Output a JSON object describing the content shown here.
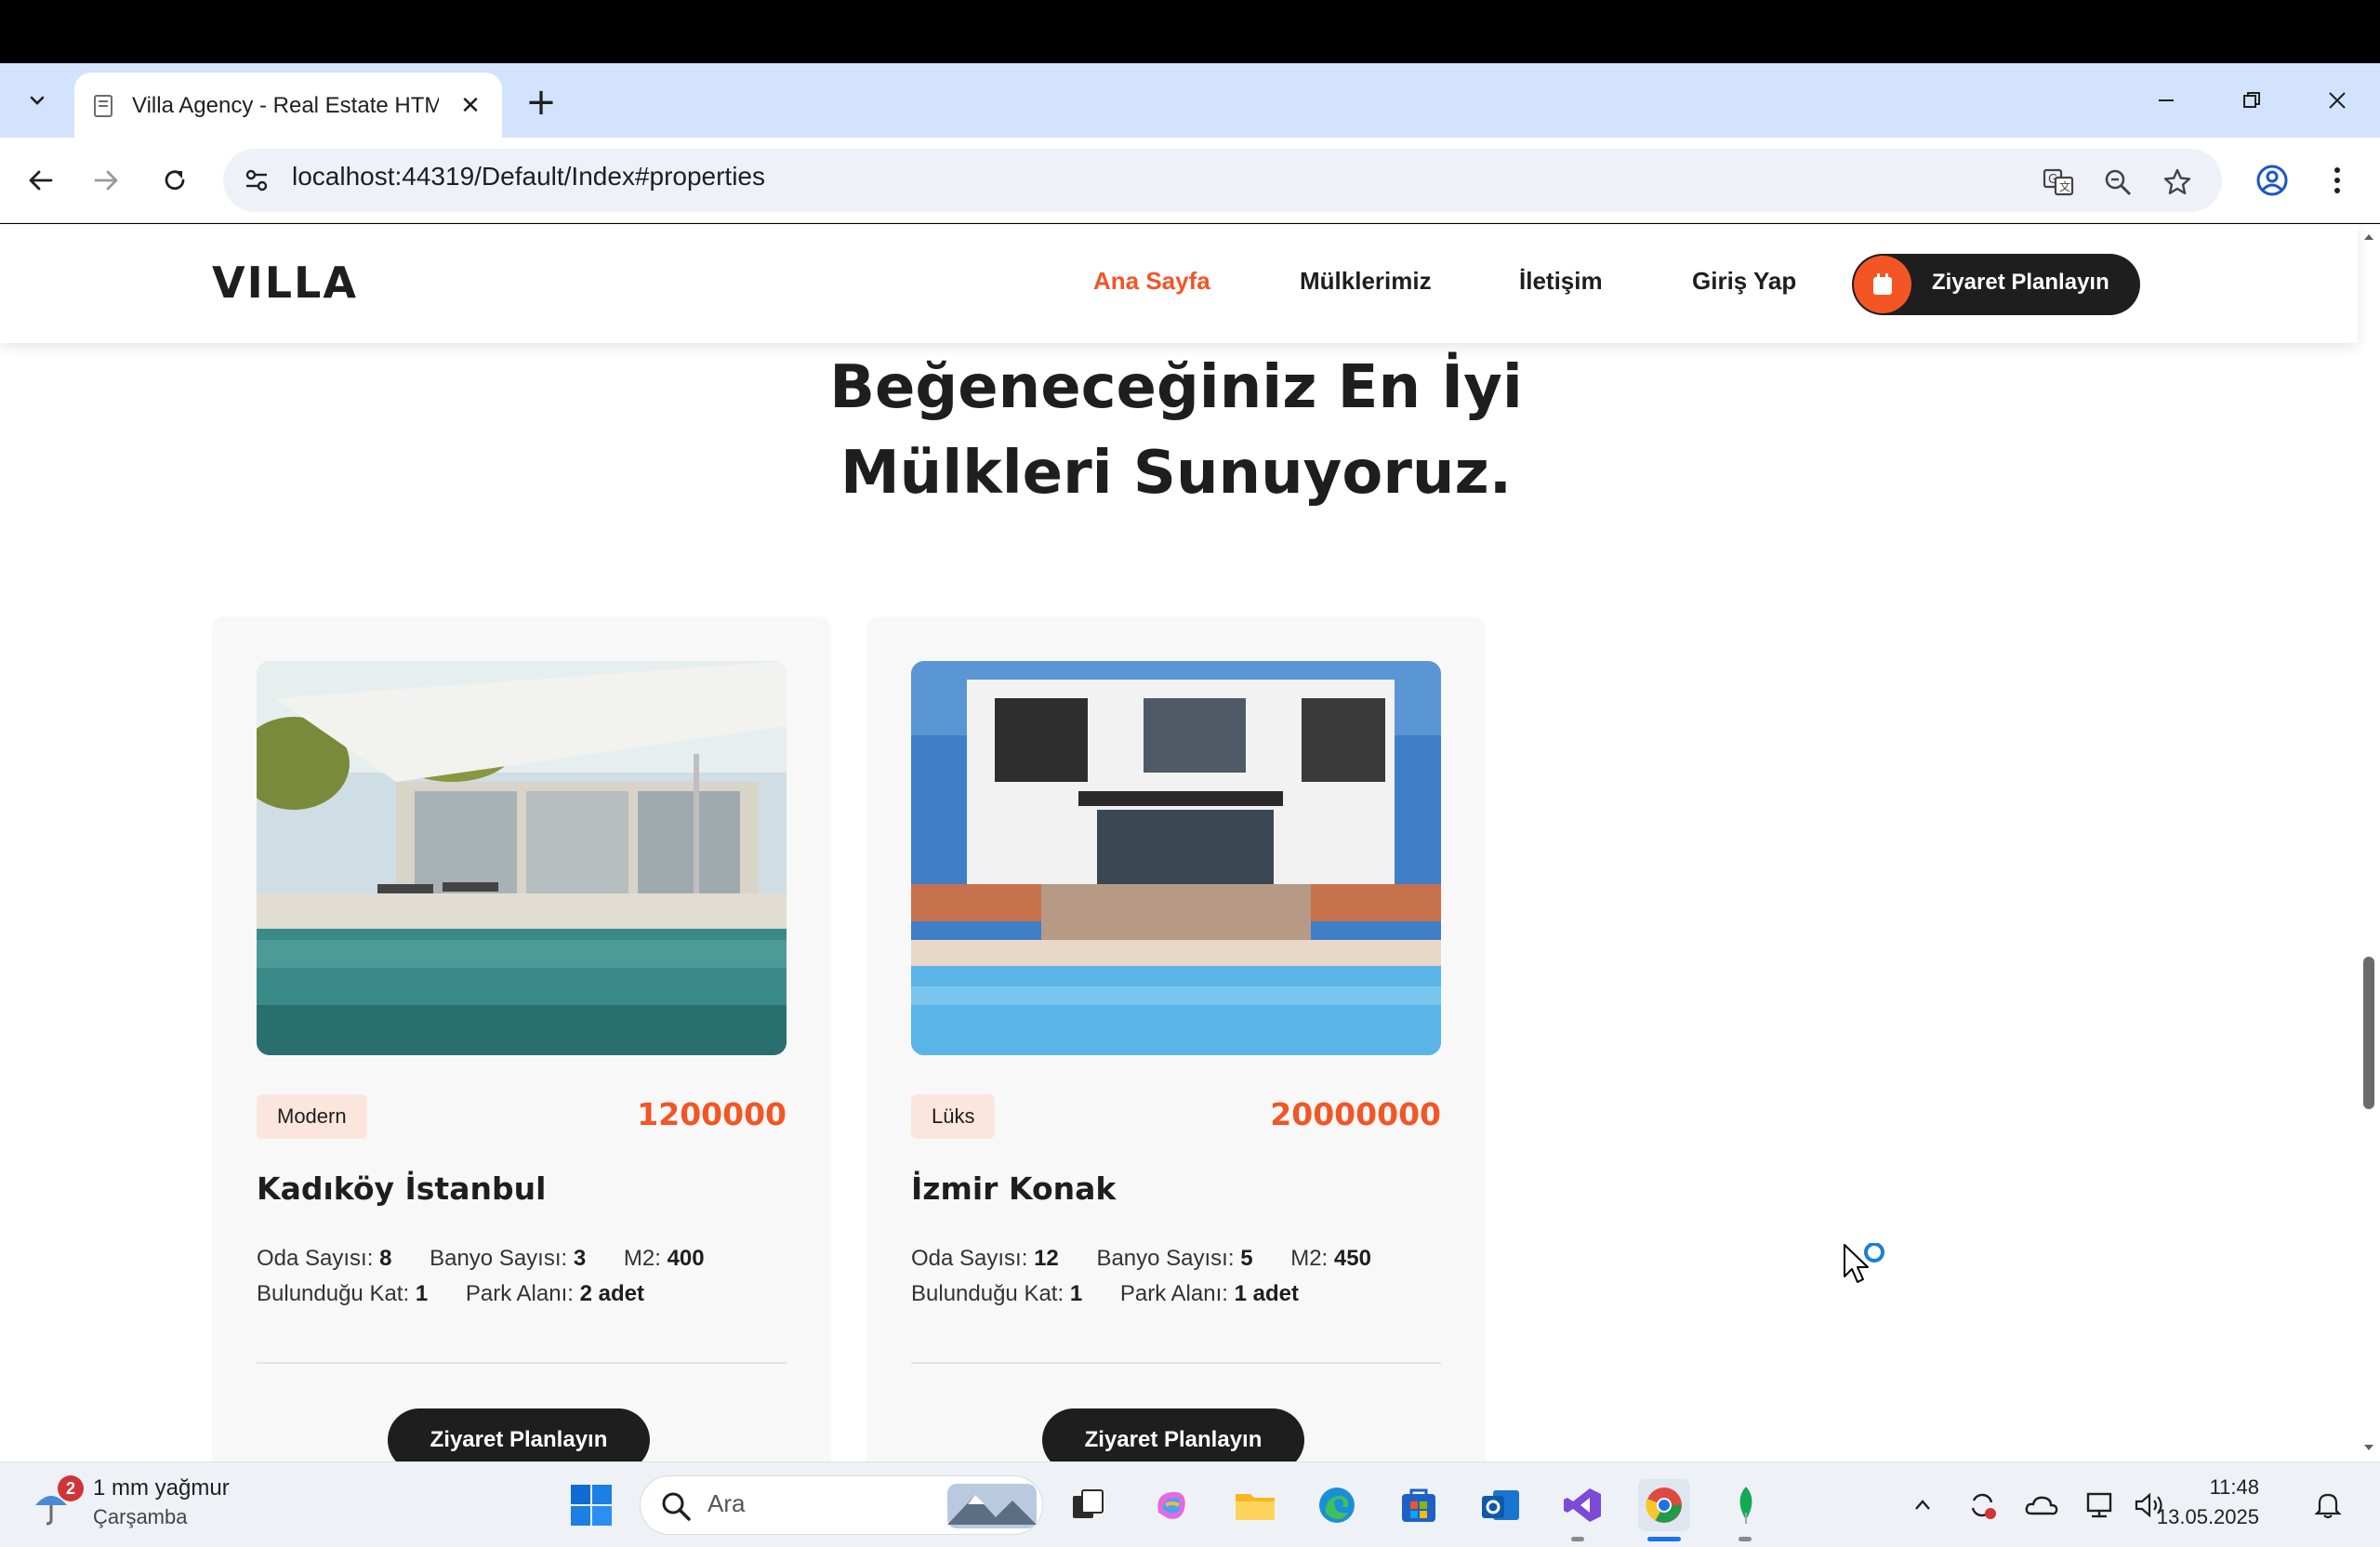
{
  "browser": {
    "tab_title": "Villa Agency - Real Estate HTML",
    "url": "localhost:44319/Default/Index#properties"
  },
  "header": {
    "logo": "VILLA",
    "nav": [
      {
        "label": "Ana Sayfa",
        "active": true
      },
      {
        "label": "Mülklerimiz",
        "active": false
      },
      {
        "label": "İletişim",
        "active": false
      },
      {
        "label": "Giriş Yap",
        "active": false
      }
    ],
    "cta_label": "Ziyaret Planlayın"
  },
  "section": {
    "title_line1": "Beğeneceğiniz En İyi",
    "title_line2": "Mülkleri Sunuyoruz."
  },
  "properties": [
    {
      "category": "Modern",
      "price": "1200000",
      "title": "Kadıköy İstanbul",
      "specs": {
        "rooms_label": "Oda Sayısı:",
        "rooms": "8",
        "baths_label": "Banyo Sayısı:",
        "baths": "3",
        "area_label": "M2:",
        "area": "400",
        "floor_label": "Bulunduğu Kat:",
        "floor": "1",
        "parking_label": "Park Alanı:",
        "parking": "2 adet"
      },
      "button": "Ziyaret Planlayın"
    },
    {
      "category": "Lüks",
      "price": "20000000",
      "title": "İzmir Konak",
      "specs": {
        "rooms_label": "Oda Sayısı:",
        "rooms": "12",
        "baths_label": "Banyo Sayısı:",
        "baths": "5",
        "area_label": "M2:",
        "area": "450",
        "floor_label": "Bulunduğu Kat:",
        "floor": "1",
        "parking_label": "Park Alanı:",
        "parking": "1 adet"
      },
      "button": "Ziyaret Planlayın"
    }
  ],
  "taskbar": {
    "weather_badge": "2",
    "weather_text": "1 mm yağmur",
    "weather_day": "Çarşamba",
    "search_placeholder": "Ara",
    "time": "11:48",
    "date": "13.05.2025"
  },
  "colors": {
    "accent": "#f35525",
    "dark": "#1e1e1e",
    "badge_bg": "#fbe6de",
    "tabbar": "#d3e3fd"
  }
}
